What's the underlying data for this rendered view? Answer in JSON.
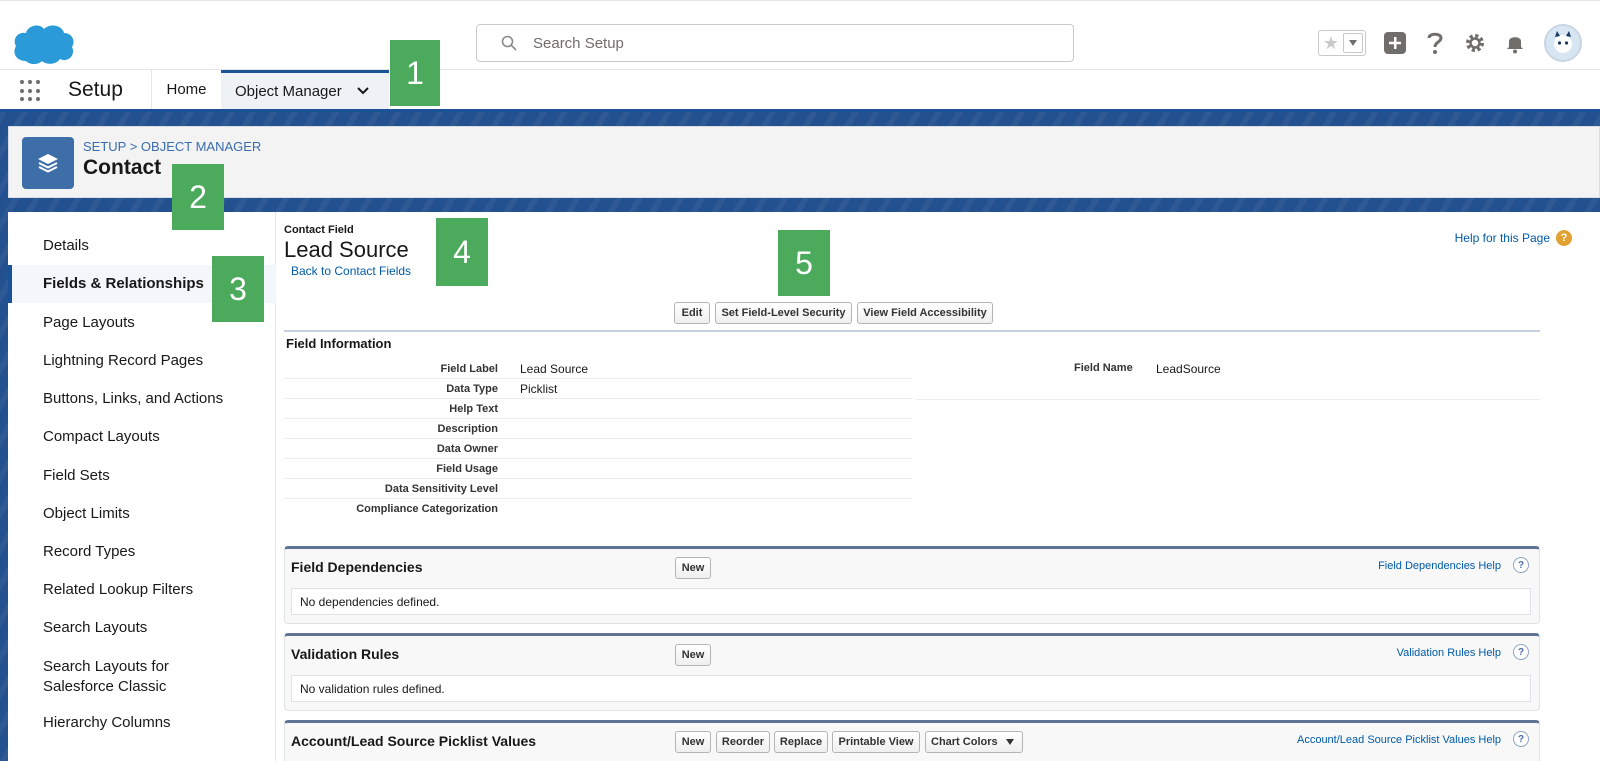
{
  "header": {
    "search_placeholder": "Search Setup",
    "icons": [
      "salesforce-cloud-logo",
      "search-icon",
      "star-icon",
      "chevron-down-icon",
      "plus-icon",
      "help-icon",
      "gear-icon",
      "bell-icon",
      "avatar"
    ]
  },
  "nav": {
    "app_name": "Setup",
    "tabs": [
      {
        "label": "Home",
        "active": false
      },
      {
        "label": "Object Manager",
        "active": true
      }
    ]
  },
  "page_header": {
    "breadcrumb": "SETUP > OBJECT MANAGER",
    "title": "Contact"
  },
  "sidebar": {
    "items": [
      {
        "label": "Details"
      },
      {
        "label": "Fields & Relationships",
        "active": true
      },
      {
        "label": "Page Layouts"
      },
      {
        "label": "Lightning Record Pages"
      },
      {
        "label": "Buttons, Links, and Actions"
      },
      {
        "label": "Compact Layouts"
      },
      {
        "label": "Field Sets"
      },
      {
        "label": "Object Limits"
      },
      {
        "label": "Record Types"
      },
      {
        "label": "Related Lookup Filters"
      },
      {
        "label": "Search Layouts"
      },
      {
        "label": "Search Layouts for Salesforce Classic"
      },
      {
        "label": "Hierarchy Columns"
      }
    ]
  },
  "field": {
    "small_label": "Contact Field",
    "title": "Lead Source",
    "back_link": "Back to Contact Fields",
    "help_link": "Help for this Page",
    "buttons": {
      "edit": "Edit",
      "fls": "Set Field-Level Security",
      "access": "View Field Accessibility"
    },
    "section_title": "Field Information",
    "info": [
      {
        "label": "Field Label",
        "value": "Lead Source"
      },
      {
        "label": "Data Type",
        "value": "Picklist"
      },
      {
        "label": "Help Text",
        "value": ""
      },
      {
        "label": "Description",
        "value": ""
      },
      {
        "label": "Data Owner",
        "value": ""
      },
      {
        "label": "Field Usage",
        "value": ""
      },
      {
        "label": "Data Sensitivity Level",
        "value": ""
      },
      {
        "label": "Compliance Categorization",
        "value": ""
      }
    ],
    "field_name_label": "Field Name",
    "field_name_value": "LeadSource"
  },
  "related": {
    "dependencies": {
      "title": "Field Dependencies",
      "new": "New",
      "help": "Field Dependencies Help",
      "body": "No dependencies defined."
    },
    "validation": {
      "title": "Validation Rules",
      "new": "New",
      "help": "Validation Rules Help",
      "body": "No validation rules defined."
    },
    "picklist": {
      "title": "Account/Lead Source Picklist Values",
      "buttons": [
        "New",
        "Reorder",
        "Replace",
        "Printable View",
        "Chart Colors"
      ],
      "help": "Account/Lead Source Picklist Values Help"
    },
    "help_glyph": "?"
  },
  "callouts": [
    "1",
    "2",
    "3",
    "4",
    "5"
  ],
  "colors": {
    "brand_blue": "#1b5297",
    "callout_green": "#4caa5c",
    "link_blue": "#015ba7"
  }
}
